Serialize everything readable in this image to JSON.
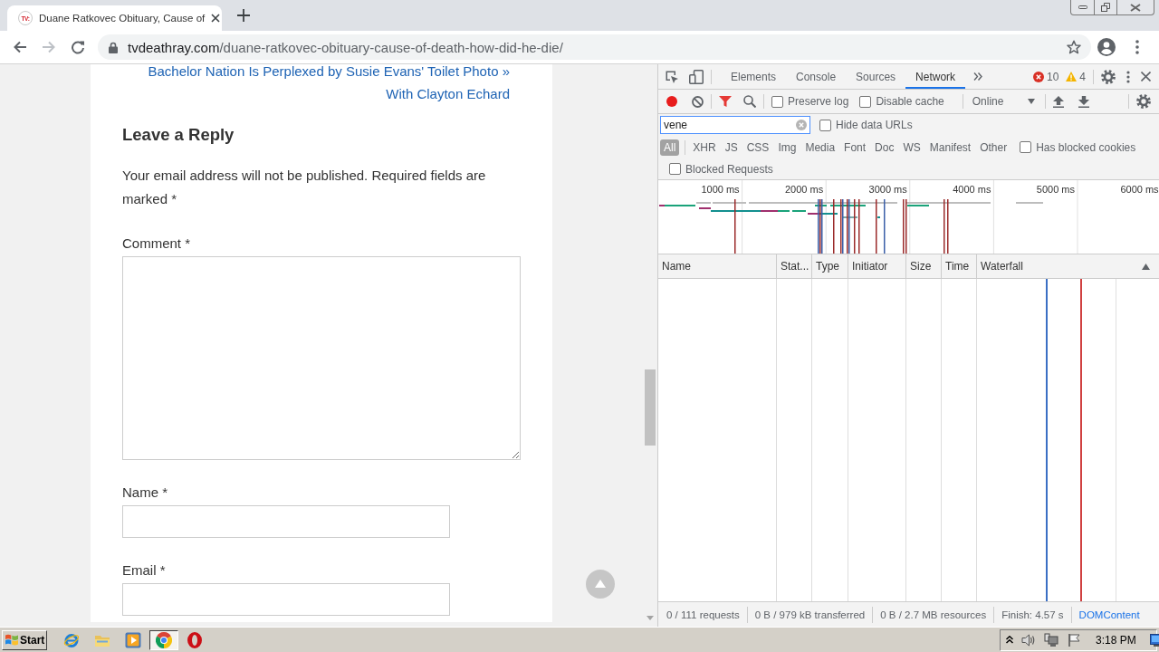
{
  "browser": {
    "tab": {
      "favicon_label": "TV:",
      "title": "Duane Ratkovec Obituary, Cause of"
    },
    "address": {
      "domain": "tvdeathray.com",
      "path": "/duane-ratkovec-obituary-cause-of-death-how-did-he-die/"
    }
  },
  "page": {
    "next_post_link": [
      "Bachelor Nation Is Perplexed by Susie Evans' Toilet Photo »",
      "With Clayton Echard"
    ],
    "reply": {
      "heading": "Leave a Reply",
      "notes": "Your email address will not be published. Required fields are marked *",
      "fields": [
        {
          "kind": "textarea",
          "label": "Comment *"
        },
        {
          "kind": "text",
          "label": "Name *"
        },
        {
          "kind": "text",
          "label": "Email *"
        }
      ]
    }
  },
  "devtools": {
    "panel_tabs": [
      {
        "label": "Elements",
        "selected": false
      },
      {
        "label": "Console",
        "selected": false
      },
      {
        "label": "Sources",
        "selected": false
      },
      {
        "label": "Network",
        "selected": true
      }
    ],
    "issues": {
      "errors": "10",
      "warnings": "4"
    },
    "toolbar": {
      "recording": true,
      "filter_active": true,
      "preserve_log": {
        "label": "Preserve log",
        "checked": false
      },
      "disable_cache": {
        "label": "Disable cache",
        "checked": false
      },
      "throttling": "Online"
    },
    "filter": {
      "value": "vene",
      "hide_data_urls": {
        "label": "Hide data URLs",
        "checked": false
      },
      "types": [
        {
          "label": "All",
          "selected": true
        },
        {
          "label": "XHR",
          "selected": false
        },
        {
          "label": "JS",
          "selected": false
        },
        {
          "label": "CSS",
          "selected": false
        },
        {
          "label": "Img",
          "selected": false
        },
        {
          "label": "Media",
          "selected": false
        },
        {
          "label": "Font",
          "selected": false
        },
        {
          "label": "Doc",
          "selected": false
        },
        {
          "label": "WS",
          "selected": false
        },
        {
          "label": "Manifest",
          "selected": false
        },
        {
          "label": "Other",
          "selected": false
        }
      ],
      "has_blocked_cookies": {
        "label": "Has blocked cookies",
        "checked": false
      },
      "blocked_requests": {
        "label": "Blocked Requests",
        "checked": false
      }
    },
    "overview": {
      "ticks": [
        "1000 ms",
        "2000 ms",
        "3000 ms",
        "4000 ms",
        "5000 ms",
        "6000 ms"
      ]
    },
    "table": {
      "columns": [
        {
          "label": "Name",
          "sorted": false
        },
        {
          "label": "Stat...",
          "sorted": false
        },
        {
          "label": "Type",
          "sorted": false
        },
        {
          "label": "Initiator",
          "sorted": false
        },
        {
          "label": "Size",
          "sorted": false
        },
        {
          "label": "Time",
          "sorted": false
        },
        {
          "label": "Waterfall",
          "sorted": true
        }
      ]
    },
    "status_bar": [
      {
        "kind": "stat",
        "text": "0 / 111 requests"
      },
      {
        "kind": "stat",
        "text": "0 B / 979 kB transferred"
      },
      {
        "kind": "stat",
        "text": "0 B / 2.7 MB resources"
      },
      {
        "kind": "stat",
        "text": "Finish: 4.57 s"
      },
      {
        "kind": "event",
        "text": "DOMContent"
      }
    ]
  },
  "taskbar": {
    "start": "Start",
    "apps": [
      {
        "selected": false
      },
      {
        "selected": false
      },
      {
        "selected": false
      },
      {
        "selected": true
      },
      {
        "selected": false
      }
    ],
    "clock": "3:18 PM"
  }
}
